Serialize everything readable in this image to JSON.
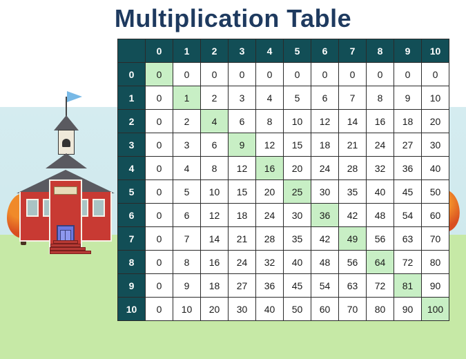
{
  "title": "Multiplication Table",
  "chart_data": {
    "type": "table",
    "title": "Multiplication Table",
    "row_headers": [
      0,
      1,
      2,
      3,
      4,
      5,
      6,
      7,
      8,
      9,
      10
    ],
    "col_headers": [
      0,
      1,
      2,
      3,
      4,
      5,
      6,
      7,
      8,
      9,
      10
    ],
    "values": [
      [
        0,
        0,
        0,
        0,
        0,
        0,
        0,
        0,
        0,
        0,
        0
      ],
      [
        0,
        1,
        2,
        3,
        4,
        5,
        6,
        7,
        8,
        9,
        10
      ],
      [
        0,
        2,
        4,
        6,
        8,
        10,
        12,
        14,
        16,
        18,
        20
      ],
      [
        0,
        3,
        6,
        9,
        12,
        15,
        18,
        21,
        24,
        27,
        30
      ],
      [
        0,
        4,
        8,
        12,
        16,
        20,
        24,
        28,
        32,
        36,
        40
      ],
      [
        0,
        5,
        10,
        15,
        20,
        25,
        30,
        35,
        40,
        45,
        50
      ],
      [
        0,
        6,
        12,
        18,
        24,
        30,
        36,
        42,
        48,
        54,
        60
      ],
      [
        0,
        7,
        14,
        21,
        28,
        35,
        42,
        49,
        56,
        63,
        70
      ],
      [
        0,
        8,
        16,
        24,
        32,
        40,
        48,
        56,
        64,
        72,
        80
      ],
      [
        0,
        9,
        18,
        27,
        36,
        45,
        54,
        63,
        72,
        81,
        90
      ],
      [
        0,
        10,
        20,
        30,
        40,
        50,
        60,
        70,
        80,
        90,
        100
      ]
    ],
    "highlight": "diagonal_perfect_squares",
    "highlight_color": "#c8efc5",
    "header_color": "#124e56"
  }
}
